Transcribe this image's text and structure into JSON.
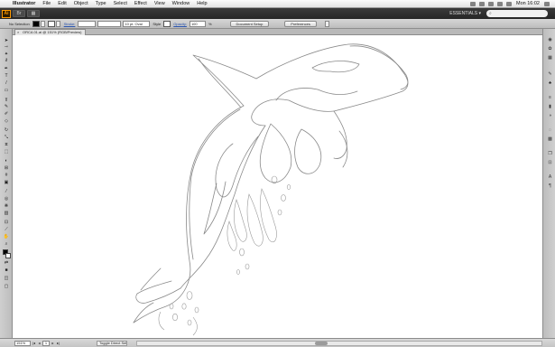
{
  "menubar": {
    "app": "Illustrator",
    "items": [
      "File",
      "Edit",
      "Object",
      "Type",
      "Select",
      "Effect",
      "View",
      "Window",
      "Help"
    ],
    "clock": "Mon 16:02"
  },
  "appbar": {
    "logo": "Ai",
    "workspace": "ESSENTIALS ▾",
    "search_placeholder": "",
    "cslive": "CS Live"
  },
  "control": {
    "selection_label": "No Selection",
    "stroke_label": "Stroke:",
    "stroke_weight": "",
    "brush_label": "10 pt. Oval",
    "style_label": "Style",
    "opacity_label": "Opacity:",
    "opacity_value": "100",
    "percent": "%",
    "doc_setup_btn": "Document Setup",
    "preferences_btn": "Preferences"
  },
  "document": {
    "tab_title": "ORCA 01.ai @ 151% (RGB/Preview)"
  },
  "status": {
    "zoom": "151%",
    "page": "1",
    "selection_tool": "Toggle Direct Selection"
  },
  "icons": {
    "toolbox": [
      "selection-arrow",
      "direct-selection",
      "magic-wand",
      "lasso",
      "pen",
      "type",
      "line-segment",
      "rectangle",
      "paintbrush",
      "pencil",
      "blob-brush",
      "eraser",
      "rotate",
      "scale",
      "width",
      "free-transform",
      "shape-builder",
      "perspective-grid",
      "mesh",
      "gradient",
      "eyedropper",
      "blend",
      "symbol-sprayer",
      "column-graph",
      "artboard",
      "slice",
      "hand",
      "zoom"
    ],
    "dock": [
      "color",
      "color-guide",
      "swatches",
      "brushes",
      "symbols",
      "stroke",
      "gradient",
      "transparency",
      "appearance",
      "graphic-styles",
      "layers",
      "artboards",
      "character",
      "paragraph"
    ]
  },
  "colors": {
    "menubar": "#ececec",
    "appbar": "#2e2e2e",
    "accent": "#ff9a00",
    "canvas": "#ffffff",
    "sketch_stroke": "#8a8a8a"
  }
}
